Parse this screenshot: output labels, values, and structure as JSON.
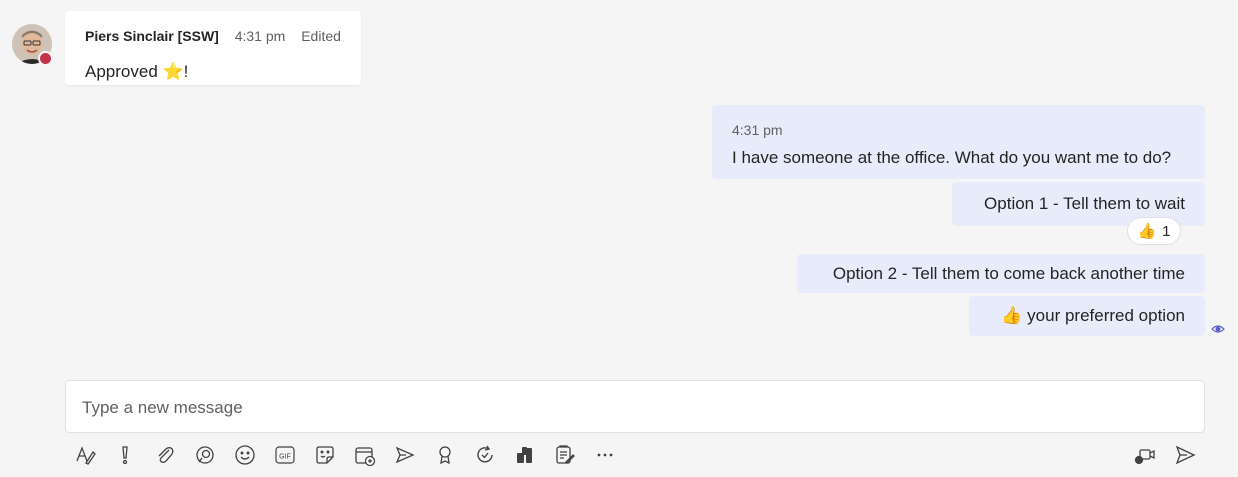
{
  "incoming": {
    "sender": "Piers Sinclair [SSW]",
    "time": "4:31 pm",
    "edited": "Edited",
    "text": "Approved ⭐!"
  },
  "outgoing": {
    "time": "4:31 pm",
    "messages": [
      "I have someone at the office. What do you want me to do?",
      "Option 1 - Tell them to wait",
      "Option 2 - Tell them to come back another time",
      "👍 your preferred option"
    ],
    "reaction": {
      "emoji": "👍",
      "count": "1"
    }
  },
  "composer": {
    "placeholder": "Type a new message"
  },
  "toolbar": {
    "icons": [
      "format-icon",
      "important-icon",
      "attach-icon",
      "loop-icon",
      "emoji-icon",
      "gif-icon",
      "sticker-icon",
      "schedule-meeting-icon",
      "stream-icon",
      "praise-icon",
      "updates-icon",
      "app-icon",
      "approvals-icon",
      "more-icon",
      "meet-now-icon",
      "send-icon"
    ]
  },
  "colors": {
    "bubble": "#e8ebfa",
    "accent": "#5b5fc7",
    "status_busy": "#c4314b"
  }
}
